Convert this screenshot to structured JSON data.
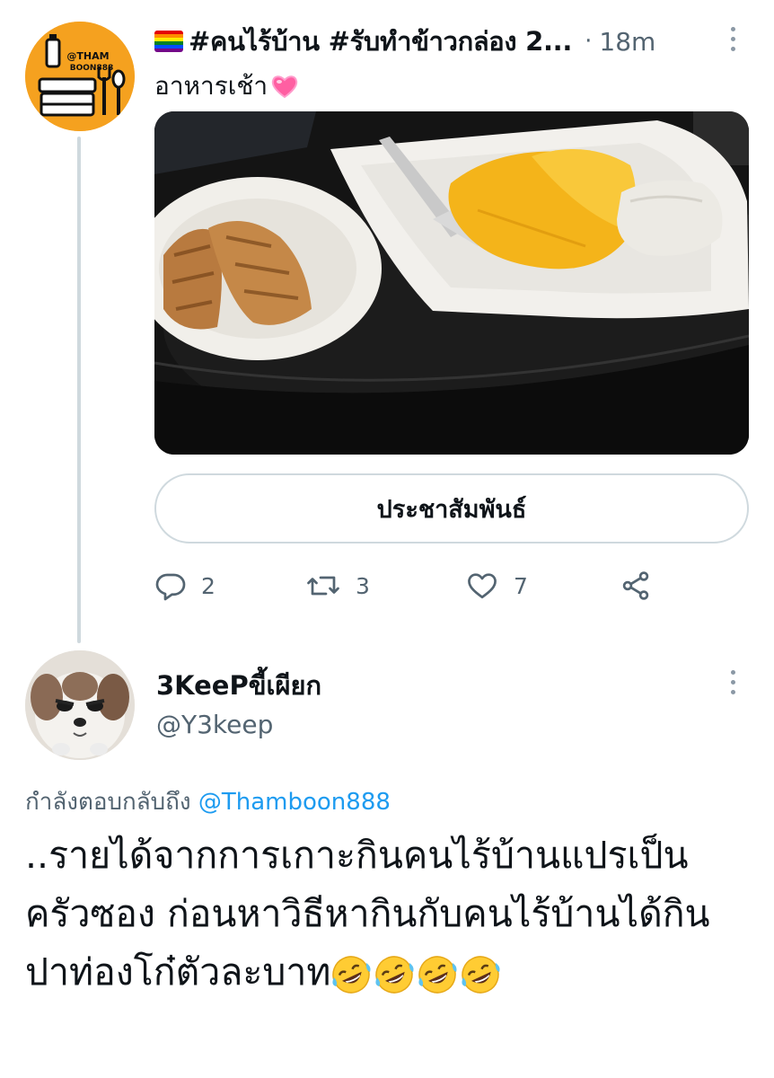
{
  "tweet": {
    "author_name": "#คนไร้บ้าน #รับทำข้าวกล่อง 2...",
    "time_separator": "·",
    "time": "18m",
    "text": "อาหารเช้า",
    "avatar_text_line1": "@THAM",
    "avatar_text_line2": "BOON888",
    "promoted_button": "ประชาสัมพันธ์",
    "actions": {
      "replies": "2",
      "retweets": "3",
      "likes": "7"
    }
  },
  "reply": {
    "author_name": "3KeePขี้เผียก",
    "handle": "@Y3keep",
    "replying_to_label": "กำลังตอบกลับถึง",
    "replying_to_mention": "@Thamboon888",
    "text": "..รายได้จากการเกาะกินคนไร้บ้านแปรเป็นครัวซอง ก่อนหาวิธีหากินกับคนไร้บ้านได้กินปาท่องโก๋ตัวละบาท"
  },
  "colors": {
    "accent": "#1d9bf0",
    "secondary_text": "#536471",
    "border": "#cfd9de",
    "avatar_bg": "#f5a11f"
  },
  "icons": [
    "rainbow-flag-icon",
    "pink-heart-emoji",
    "reply-icon",
    "retweet-icon",
    "like-icon",
    "share-icon",
    "more-options-icon",
    "rolling-laughing-emoji"
  ]
}
